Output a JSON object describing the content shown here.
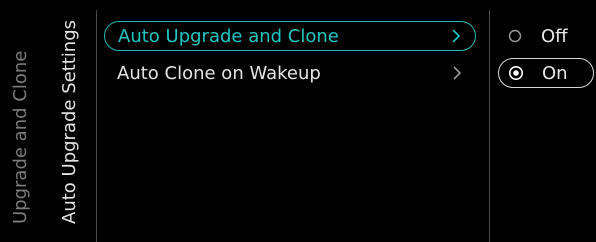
{
  "breadcrumb": {
    "parent": "Upgrade and Clone",
    "current": "Auto Upgrade Settings"
  },
  "menu": {
    "items": [
      {
        "label": "Auto Upgrade and Clone",
        "selected": true
      },
      {
        "label": "Auto Clone on Wakeup",
        "selected": false
      }
    ]
  },
  "options": {
    "items": [
      {
        "label": "Off",
        "checked": false
      },
      {
        "label": "On",
        "checked": true
      }
    ]
  },
  "colors": {
    "background": "#000000",
    "accent": "#1fb7b4",
    "text": "#e4e4e4",
    "muted": "#7c7c7c",
    "divider": "#4a4a4a"
  },
  "icons": {
    "chevron": "chevron-right-icon",
    "radio_empty": "radio-unselected-icon",
    "radio_checked": "radio-selected-icon"
  }
}
